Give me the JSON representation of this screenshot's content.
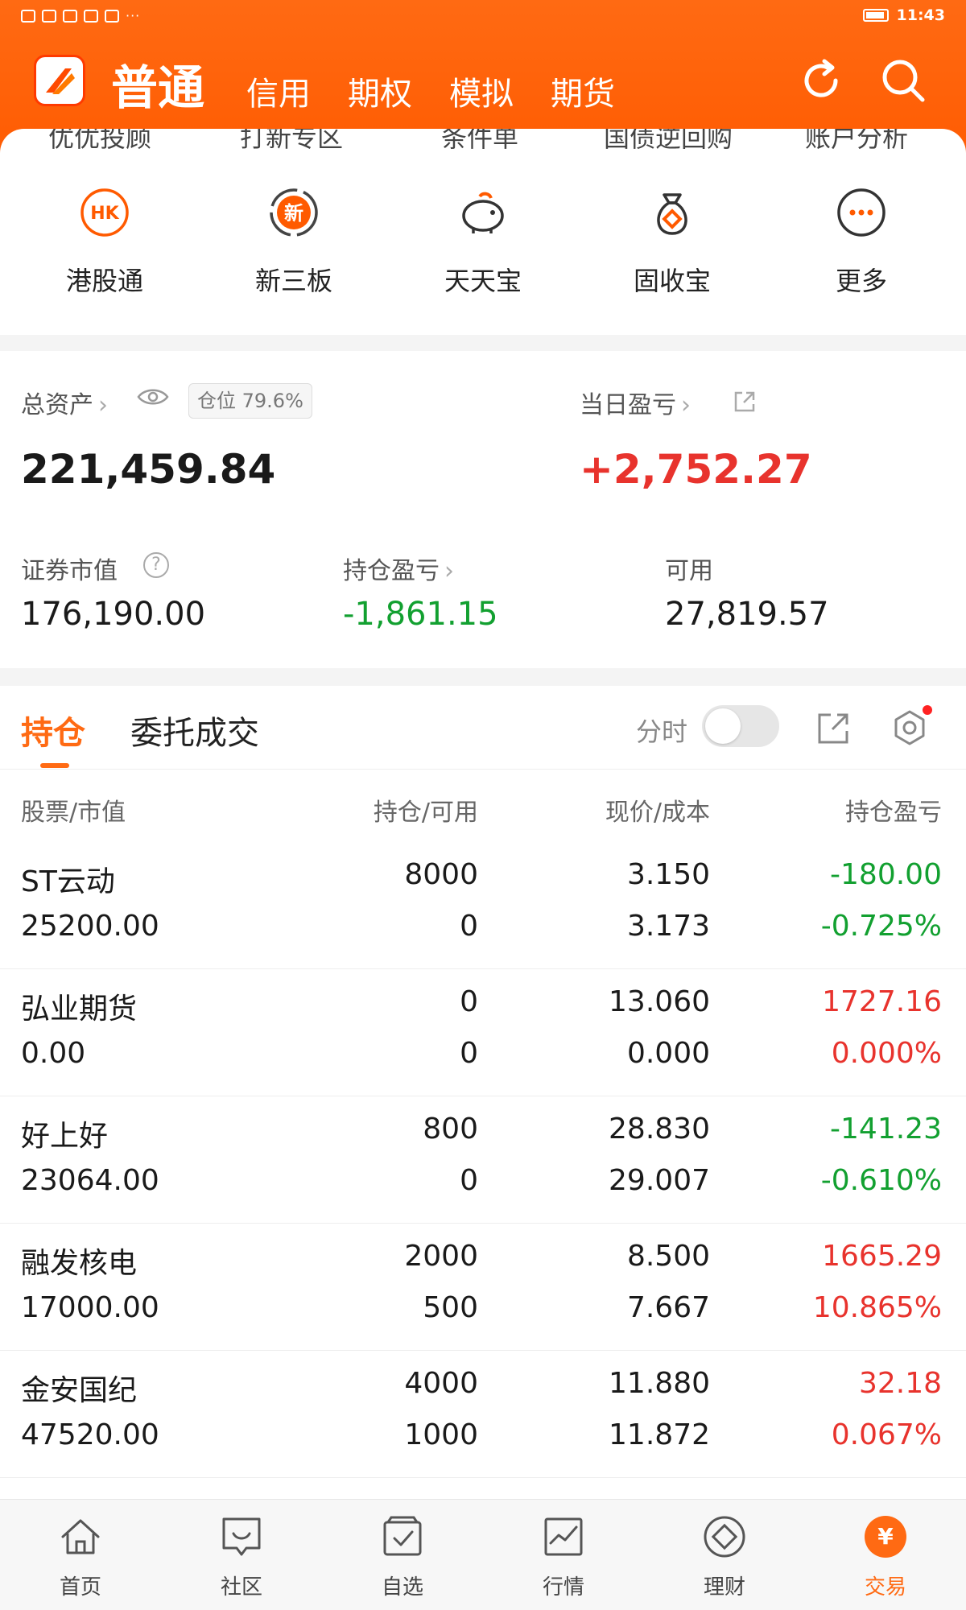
{
  "status_bar": {
    "time": "11:43",
    "left_indicators": "···"
  },
  "nav": {
    "active": "普通",
    "tabs": [
      "信用",
      "期权",
      "模拟",
      "期货"
    ],
    "refresh_icon": "refresh-icon",
    "search_icon": "search-icon"
  },
  "peek_row": [
    "优优投顾",
    "打新专区",
    "条件单",
    "国债逆回购",
    "账户分析"
  ],
  "quick_actions": [
    {
      "label": "港股通",
      "icon": "hk-icon",
      "icon_text": "HK"
    },
    {
      "label": "新三板",
      "icon": "new-board-icon",
      "icon_text": "新"
    },
    {
      "label": "天天宝",
      "icon": "piggy-bank-icon"
    },
    {
      "label": "固收宝",
      "icon": "money-bag-icon"
    },
    {
      "label": "更多",
      "icon": "more-icon"
    }
  ],
  "assets": {
    "total_label": "总资产",
    "total_value": "221,459.84",
    "position_badge": "仓位 79.6%",
    "daily_pnl_label": "当日盈亏",
    "daily_pnl_value": "+2,752.27",
    "market_value_label": "证券市值",
    "market_value": "176,190.00",
    "holding_pnl_label": "持仓盈亏",
    "holding_pnl_value": "-1,861.15",
    "available_label": "可用",
    "available_value": "27,819.57",
    "colors": {
      "up": "#e8332d",
      "down": "#12a030",
      "accent": "#ff6a13"
    }
  },
  "holdings": {
    "tabs": [
      "持仓",
      "委托成交"
    ],
    "toggle_label": "分时",
    "columns": [
      "股票/市值",
      "持仓/可用",
      "现价/成本",
      "持仓盈亏"
    ],
    "rows": [
      {
        "name": "ST云动",
        "market_value": "25200.00",
        "position": "8000",
        "available": "0",
        "price": "3.150",
        "cost": "3.173",
        "pnl": "-180.00",
        "pnl_pct": "-0.725%",
        "trend": "down"
      },
      {
        "name": "弘业期货",
        "market_value": "0.00",
        "position": "0",
        "available": "0",
        "price": "13.060",
        "cost": "0.000",
        "pnl": "1727.16",
        "pnl_pct": "0.000%",
        "trend": "up"
      },
      {
        "name": "好上好",
        "market_value": "23064.00",
        "position": "800",
        "available": "0",
        "price": "28.830",
        "cost": "29.007",
        "pnl": "-141.23",
        "pnl_pct": "-0.610%",
        "trend": "down"
      },
      {
        "name": "融发核电",
        "market_value": "17000.00",
        "position": "2000",
        "available": "500",
        "price": "8.500",
        "cost": "7.667",
        "pnl": "1665.29",
        "pnl_pct": "10.865%",
        "trend": "up"
      },
      {
        "name": "金安国纪",
        "market_value": "47520.00",
        "position": "4000",
        "available": "1000",
        "price": "11.880",
        "cost": "11.872",
        "pnl": "32.18",
        "pnl_pct": "0.067%",
        "trend": "up"
      }
    ]
  },
  "bottom_nav": [
    {
      "label": "首页",
      "icon": "home-icon"
    },
    {
      "label": "社区",
      "icon": "community-icon"
    },
    {
      "label": "自选",
      "icon": "watchlist-icon"
    },
    {
      "label": "行情",
      "icon": "market-chart-icon"
    },
    {
      "label": "理财",
      "icon": "wealth-icon"
    },
    {
      "label": "交易",
      "icon": "trade-icon",
      "active": true,
      "icon_text": "¥"
    }
  ]
}
